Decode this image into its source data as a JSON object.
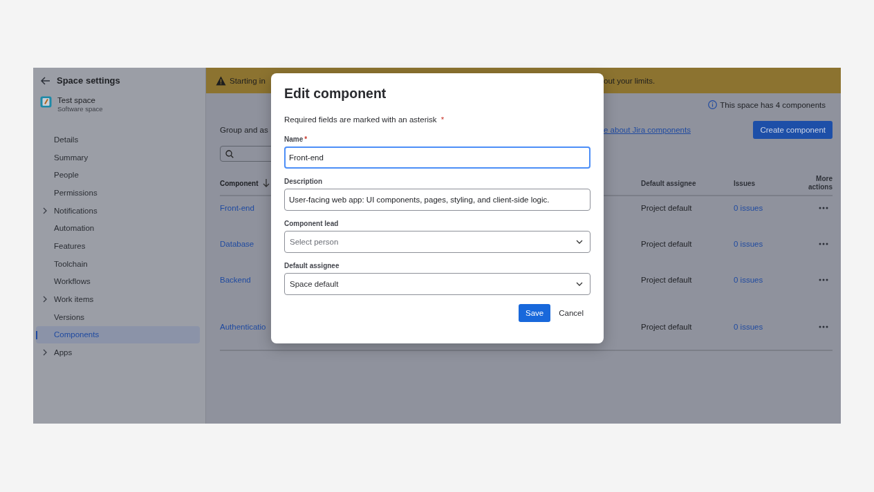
{
  "sidebar": {
    "back_label": "Space settings",
    "space": {
      "name": "Test space",
      "type": "Software space"
    },
    "items": [
      {
        "label": "Details",
        "expandable": false,
        "selected": false
      },
      {
        "label": "Summary",
        "expandable": false,
        "selected": false
      },
      {
        "label": "People",
        "expandable": false,
        "selected": false
      },
      {
        "label": "Permissions",
        "expandable": false,
        "selected": false
      },
      {
        "label": "Notifications",
        "expandable": true,
        "selected": false
      },
      {
        "label": "Automation",
        "expandable": false,
        "selected": false
      },
      {
        "label": "Features",
        "expandable": false,
        "selected": false
      },
      {
        "label": "Toolchain",
        "expandable": false,
        "selected": false
      },
      {
        "label": "Workflows",
        "expandable": false,
        "selected": false
      },
      {
        "label": "Work items",
        "expandable": true,
        "selected": false
      },
      {
        "label": "Versions",
        "expandable": false,
        "selected": false
      },
      {
        "label": "Components",
        "expandable": false,
        "selected": true
      },
      {
        "label": "Apps",
        "expandable": true,
        "selected": false
      }
    ]
  },
  "banner": {
    "text_start": "Starting in",
    "text_end": "out your limits."
  },
  "main": {
    "info": "This space has 4 components",
    "intro": "Group and as",
    "link": "e about Jira components",
    "create_button": "Create component",
    "table": {
      "columns": [
        {
          "label": "Component",
          "sorted": true
        },
        {
          "label": "Default assignee",
          "sorted": false
        },
        {
          "label": "Issues",
          "sorted": false
        },
        {
          "label": "More actions",
          "sorted": false
        }
      ],
      "rows": [
        {
          "component": "Front-end",
          "default_assignee": "Project default",
          "issues": "0 issues"
        },
        {
          "component": "Database",
          "default_assignee": "Project default",
          "issues": "0 issues"
        },
        {
          "component": "Backend",
          "default_assignee": "Project default",
          "issues": "0 issues"
        },
        {
          "component": "Authenticatio",
          "default_assignee": "Project default",
          "issues": "0 issues"
        }
      ]
    }
  },
  "dialog": {
    "title": "Edit component",
    "required_note": "Required fields are marked with an asterisk",
    "required_mark": "*",
    "fields": [
      {
        "kind": "text",
        "label": "Name",
        "required": true,
        "focused": true,
        "value": "Front-end"
      },
      {
        "kind": "text",
        "label": "Description",
        "required": false,
        "focused": false,
        "value": "User-facing web app: UI components, pages, styling, and client-side logic."
      },
      {
        "kind": "select",
        "label": "Component lead",
        "required": false,
        "focused": false,
        "placeholder": "Select person"
      },
      {
        "kind": "select",
        "label": "Default assignee",
        "required": false,
        "focused": false,
        "value": "Space default"
      }
    ],
    "buttons": [
      {
        "kind": "primary",
        "label": "Save"
      },
      {
        "kind": "subtle",
        "label": "Cancel"
      }
    ]
  }
}
